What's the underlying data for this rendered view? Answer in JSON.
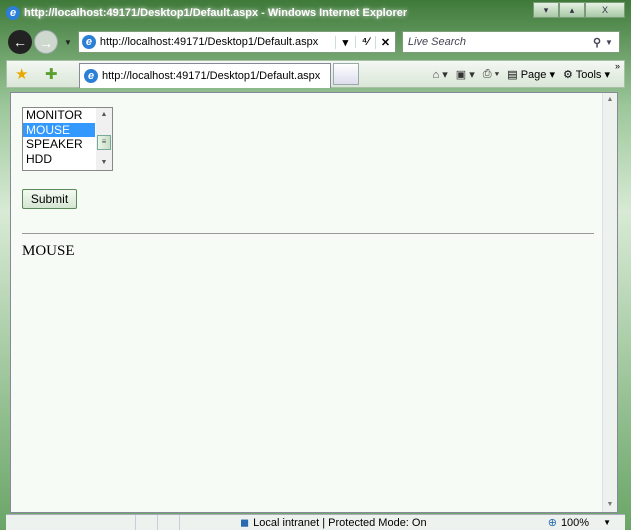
{
  "window": {
    "title": "http://localhost:49171/Desktop1/Default.aspx - Windows Internet Explorer",
    "minimize": "▾",
    "maximize": "▴",
    "close": "X"
  },
  "toolbar": {
    "address": "http://localhost:49171/Desktop1/Default.aspx",
    "refresh": "⁴⁄",
    "stop": "✕",
    "search_placeholder": "Live Search",
    "search_icon": "⚲"
  },
  "tab": {
    "label": "http://localhost:49171/Desktop1/Default.aspx"
  },
  "commands": {
    "page": "Page",
    "tools": "Tools",
    "more": "»"
  },
  "page": {
    "listbox": {
      "options": [
        "MONITOR",
        "MOUSE",
        "SPEAKER",
        "HDD"
      ],
      "selected": "MOUSE"
    },
    "submit": "Submit",
    "result": "MOUSE"
  },
  "status": {
    "zone": "Local intranet | Protected Mode: On",
    "zoom": "100%"
  }
}
